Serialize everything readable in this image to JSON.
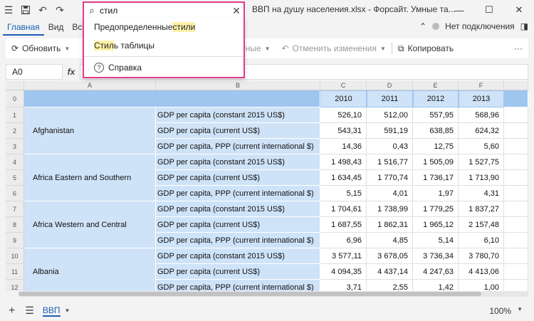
{
  "titlebar": {
    "title": "ВВП на душу населения.xlsx - Форсайт. Умные та..."
  },
  "tabs": [
    "Главная",
    "Вид",
    "Вст"
  ],
  "connection": {
    "label": "Нет подключения"
  },
  "toolbar": {
    "refresh": "Обновить",
    "data": "данные",
    "cancel_changes": "Отменить изменения",
    "copy": "Копировать",
    "more": "···"
  },
  "formula": {
    "cellref": "A0",
    "fx": "fx"
  },
  "search": {
    "query": "стил",
    "results": [
      {
        "before": "Предопределенные ",
        "match": "стили",
        "after": ""
      },
      {
        "before": "",
        "match": "Стил",
        "after": "ь таблицы"
      }
    ],
    "help": "Справка"
  },
  "grid": {
    "col_letters": [
      "A",
      "B",
      "C",
      "D",
      "E",
      "F"
    ],
    "years": [
      "2010",
      "2011",
      "2012",
      "2013"
    ],
    "row_numbers": [
      "0",
      "1",
      "2",
      "3",
      "4",
      "5",
      "6",
      "7",
      "8",
      "9",
      "10",
      "11",
      "12"
    ],
    "countries": [
      "Afghanistan",
      "Africa Eastern and Southern",
      "Africa Western and Central",
      "Albania"
    ],
    "indicators": [
      "GDP per capita (constant 2015 US$)",
      "GDP per capita (current US$)",
      "GDP per capita, PPP (current international $)"
    ],
    "rows": [
      [
        "526,10",
        "512,00",
        "557,95",
        "568,96"
      ],
      [
        "543,31",
        "591,19",
        "638,85",
        "624,32"
      ],
      [
        "14,36",
        "0,43",
        "12,75",
        "5,60"
      ],
      [
        "1 498,43",
        "1 516,77",
        "1 505,09",
        "1 527,75"
      ],
      [
        "1 634,45",
        "1 770,74",
        "1 736,17",
        "1 713,90"
      ],
      [
        "5,15",
        "4,01",
        "1,97",
        "4,31"
      ],
      [
        "1 704,61",
        "1 738,99",
        "1 779,25",
        "1 837,27"
      ],
      [
        "1 687,55",
        "1 862,31",
        "1 965,12",
        "2 157,48"
      ],
      [
        "6,96",
        "4,85",
        "5,14",
        "6,10"
      ],
      [
        "3 577,11",
        "3 678,05",
        "3 736,34",
        "3 780,70"
      ],
      [
        "4 094,35",
        "4 437,14",
        "4 247,63",
        "4 413,06"
      ],
      [
        "3,71",
        "2,55",
        "1,42",
        "1,00"
      ]
    ]
  },
  "bottom": {
    "sheet": "ВВП",
    "zoom": "100%"
  }
}
